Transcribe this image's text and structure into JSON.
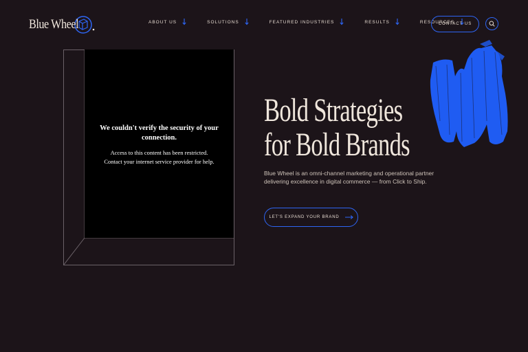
{
  "brand": {
    "name": "Blue Wheel",
    "accent": "#2e66f5",
    "background": "#1c1419"
  },
  "nav": {
    "items": [
      {
        "label": "ABOUT US"
      },
      {
        "label": "SOLUTIONS"
      },
      {
        "label": "FEATURED INDUSTRIES"
      },
      {
        "label": "RESULTS"
      },
      {
        "label": "RESOURCES"
      }
    ],
    "contact_label": "CONTACT US",
    "search_icon": "search-icon"
  },
  "embed": {
    "title": "We couldn't verify the security of your connection.",
    "line1": "Access to this content has been restricted.",
    "line2": "Contact your internet service provider for help."
  },
  "hero": {
    "title_line1": "Bold Strategies",
    "title_line2": "for Bold Brands",
    "description": "Blue Wheel is an omni-channel marketing and operational partner delivering excellence in digital commerce — from Click to Ship.",
    "cta_label": "LET'S EXPAND YOUR BRAND"
  }
}
